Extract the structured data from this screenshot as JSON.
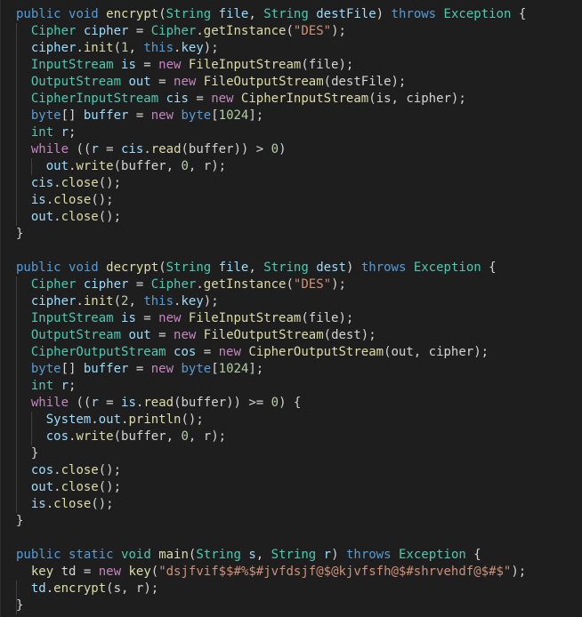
{
  "editor": {
    "language": "java",
    "theme_colors": {
      "background": "#1e1e1e",
      "keyword": "#569cd6",
      "type": "#4ec9b0",
      "function": "#dcdcaa",
      "variable": "#9cdcfe",
      "control": "#c586c0",
      "string": "#ce9178",
      "number": "#b5cea8",
      "plain": "#d4d4d4"
    },
    "lines": [
      [
        [
          "kw",
          "public"
        ],
        [
          "pl",
          " "
        ],
        [
          "kw",
          "void"
        ],
        [
          "pl",
          " "
        ],
        [
          "fn",
          "encrypt"
        ],
        [
          "pl",
          "("
        ],
        [
          "ty",
          "String"
        ],
        [
          "pl",
          " "
        ],
        [
          "var",
          "file"
        ],
        [
          "pl",
          ", "
        ],
        [
          "ty",
          "String"
        ],
        [
          "pl",
          " "
        ],
        [
          "var",
          "destFile"
        ],
        [
          "pl",
          ") "
        ],
        [
          "kw",
          "throws"
        ],
        [
          "pl",
          " "
        ],
        [
          "ty",
          "Exception"
        ],
        [
          "pl",
          " {"
        ]
      ],
      [
        [
          "pl",
          "  "
        ],
        [
          "ty",
          "Cipher"
        ],
        [
          "pl",
          " "
        ],
        [
          "var",
          "cipher"
        ],
        [
          "pl",
          " = "
        ],
        [
          "ty",
          "Cipher"
        ],
        [
          "pl",
          "."
        ],
        [
          "fn",
          "getInstance"
        ],
        [
          "pl",
          "("
        ],
        [
          "str",
          "\"DES\""
        ],
        [
          "pl",
          ");"
        ]
      ],
      [
        [
          "pl",
          "  "
        ],
        [
          "var",
          "cipher"
        ],
        [
          "pl",
          "."
        ],
        [
          "fn",
          "init"
        ],
        [
          "pl",
          "("
        ],
        [
          "num",
          "1"
        ],
        [
          "pl",
          ", "
        ],
        [
          "kw",
          "this"
        ],
        [
          "pl",
          "."
        ],
        [
          "var",
          "key"
        ],
        [
          "pl",
          ");"
        ]
      ],
      [
        [
          "pl",
          "  "
        ],
        [
          "ty",
          "InputStream"
        ],
        [
          "pl",
          " "
        ],
        [
          "var",
          "is"
        ],
        [
          "pl",
          " = "
        ],
        [
          "ctl",
          "new"
        ],
        [
          "pl",
          " "
        ],
        [
          "fn",
          "FileInputStream"
        ],
        [
          "pl",
          "(file);"
        ]
      ],
      [
        [
          "pl",
          "  "
        ],
        [
          "ty",
          "OutputStream"
        ],
        [
          "pl",
          " "
        ],
        [
          "var",
          "out"
        ],
        [
          "pl",
          " = "
        ],
        [
          "ctl",
          "new"
        ],
        [
          "pl",
          " "
        ],
        [
          "fn",
          "FileOutputStream"
        ],
        [
          "pl",
          "(destFile);"
        ]
      ],
      [
        [
          "pl",
          "  "
        ],
        [
          "ty",
          "CipherInputStream"
        ],
        [
          "pl",
          " "
        ],
        [
          "var",
          "cis"
        ],
        [
          "pl",
          " = "
        ],
        [
          "ctl",
          "new"
        ],
        [
          "pl",
          " "
        ],
        [
          "fn",
          "CipherInputStream"
        ],
        [
          "pl",
          "(is, cipher);"
        ]
      ],
      [
        [
          "pl",
          "  "
        ],
        [
          "kw",
          "byte"
        ],
        [
          "pl",
          "[] "
        ],
        [
          "var",
          "buffer"
        ],
        [
          "pl",
          " = "
        ],
        [
          "ctl",
          "new"
        ],
        [
          "pl",
          " "
        ],
        [
          "kw",
          "byte"
        ],
        [
          "pl",
          "["
        ],
        [
          "num",
          "1024"
        ],
        [
          "pl",
          "];"
        ]
      ],
      [
        [
          "pl",
          "  "
        ],
        [
          "ty",
          "int"
        ],
        [
          "pl",
          " "
        ],
        [
          "var",
          "r"
        ],
        [
          "pl",
          ";"
        ]
      ],
      [
        [
          "pl",
          "  "
        ],
        [
          "ctl",
          "while"
        ],
        [
          "pl",
          " (("
        ],
        [
          "var",
          "r"
        ],
        [
          "pl",
          " = "
        ],
        [
          "var",
          "cis"
        ],
        [
          "pl",
          "."
        ],
        [
          "fn",
          "read"
        ],
        [
          "pl",
          "(buffer)) > "
        ],
        [
          "num",
          "0"
        ],
        [
          "pl",
          ")"
        ]
      ],
      [
        [
          "pl",
          "    "
        ],
        [
          "var",
          "out"
        ],
        [
          "pl",
          "."
        ],
        [
          "fn",
          "write"
        ],
        [
          "pl",
          "(buffer, "
        ],
        [
          "num",
          "0"
        ],
        [
          "pl",
          ", r);"
        ]
      ],
      [
        [
          "pl",
          "  "
        ],
        [
          "var",
          "cis"
        ],
        [
          "pl",
          "."
        ],
        [
          "fn",
          "close"
        ],
        [
          "pl",
          "();"
        ]
      ],
      [
        [
          "pl",
          "  "
        ],
        [
          "var",
          "is"
        ],
        [
          "pl",
          "."
        ],
        [
          "fn",
          "close"
        ],
        [
          "pl",
          "();"
        ]
      ],
      [
        [
          "pl",
          "  "
        ],
        [
          "var",
          "out"
        ],
        [
          "pl",
          "."
        ],
        [
          "fn",
          "close"
        ],
        [
          "pl",
          "();"
        ]
      ],
      [
        [
          "pl",
          "}"
        ]
      ],
      [],
      [
        [
          "kw",
          "public"
        ],
        [
          "pl",
          " "
        ],
        [
          "kw",
          "void"
        ],
        [
          "pl",
          " "
        ],
        [
          "fn",
          "decrypt"
        ],
        [
          "pl",
          "("
        ],
        [
          "ty",
          "String"
        ],
        [
          "pl",
          " "
        ],
        [
          "var",
          "file"
        ],
        [
          "pl",
          ", "
        ],
        [
          "ty",
          "String"
        ],
        [
          "pl",
          " "
        ],
        [
          "var",
          "dest"
        ],
        [
          "pl",
          ") "
        ],
        [
          "kw",
          "throws"
        ],
        [
          "pl",
          " "
        ],
        [
          "ty",
          "Exception"
        ],
        [
          "pl",
          " {"
        ]
      ],
      [
        [
          "pl",
          "  "
        ],
        [
          "ty",
          "Cipher"
        ],
        [
          "pl",
          " "
        ],
        [
          "var",
          "cipher"
        ],
        [
          "pl",
          " = "
        ],
        [
          "ty",
          "Cipher"
        ],
        [
          "pl",
          "."
        ],
        [
          "fn",
          "getInstance"
        ],
        [
          "pl",
          "("
        ],
        [
          "str",
          "\"DES\""
        ],
        [
          "pl",
          ");"
        ]
      ],
      [
        [
          "pl",
          "  "
        ],
        [
          "var",
          "cipher"
        ],
        [
          "pl",
          "."
        ],
        [
          "fn",
          "init"
        ],
        [
          "pl",
          "("
        ],
        [
          "num",
          "2"
        ],
        [
          "pl",
          ", "
        ],
        [
          "kw",
          "this"
        ],
        [
          "pl",
          "."
        ],
        [
          "var",
          "key"
        ],
        [
          "pl",
          ");"
        ]
      ],
      [
        [
          "pl",
          "  "
        ],
        [
          "ty",
          "InputStream"
        ],
        [
          "pl",
          " "
        ],
        [
          "var",
          "is"
        ],
        [
          "pl",
          " = "
        ],
        [
          "ctl",
          "new"
        ],
        [
          "pl",
          " "
        ],
        [
          "fn",
          "FileInputStream"
        ],
        [
          "pl",
          "(file);"
        ]
      ],
      [
        [
          "pl",
          "  "
        ],
        [
          "ty",
          "OutputStream"
        ],
        [
          "pl",
          " "
        ],
        [
          "var",
          "out"
        ],
        [
          "pl",
          " = "
        ],
        [
          "ctl",
          "new"
        ],
        [
          "pl",
          " "
        ],
        [
          "fn",
          "FileOutputStream"
        ],
        [
          "pl",
          "(dest);"
        ]
      ],
      [
        [
          "pl",
          "  "
        ],
        [
          "ty",
          "CipherOutputStream"
        ],
        [
          "pl",
          " "
        ],
        [
          "var",
          "cos"
        ],
        [
          "pl",
          " = "
        ],
        [
          "ctl",
          "new"
        ],
        [
          "pl",
          " "
        ],
        [
          "fn",
          "CipherOutputStream"
        ],
        [
          "pl",
          "(out, cipher);"
        ]
      ],
      [
        [
          "pl",
          "  "
        ],
        [
          "kw",
          "byte"
        ],
        [
          "pl",
          "[] "
        ],
        [
          "var",
          "buffer"
        ],
        [
          "pl",
          " = "
        ],
        [
          "ctl",
          "new"
        ],
        [
          "pl",
          " "
        ],
        [
          "kw",
          "byte"
        ],
        [
          "pl",
          "["
        ],
        [
          "num",
          "1024"
        ],
        [
          "pl",
          "];"
        ]
      ],
      [
        [
          "pl",
          "  "
        ],
        [
          "ty",
          "int"
        ],
        [
          "pl",
          " "
        ],
        [
          "var",
          "r"
        ],
        [
          "pl",
          ";"
        ]
      ],
      [
        [
          "pl",
          "  "
        ],
        [
          "ctl",
          "while"
        ],
        [
          "pl",
          " (("
        ],
        [
          "var",
          "r"
        ],
        [
          "pl",
          " = "
        ],
        [
          "var",
          "is"
        ],
        [
          "pl",
          "."
        ],
        [
          "fn",
          "read"
        ],
        [
          "pl",
          "(buffer)) >= "
        ],
        [
          "num",
          "0"
        ],
        [
          "pl",
          ") {"
        ]
      ],
      [
        [
          "pl",
          "    "
        ],
        [
          "var",
          "System"
        ],
        [
          "pl",
          "."
        ],
        [
          "var",
          "out"
        ],
        [
          "pl",
          "."
        ],
        [
          "fn",
          "println"
        ],
        [
          "pl",
          "();"
        ]
      ],
      [
        [
          "pl",
          "    "
        ],
        [
          "var",
          "cos"
        ],
        [
          "pl",
          "."
        ],
        [
          "fn",
          "write"
        ],
        [
          "pl",
          "(buffer, "
        ],
        [
          "num",
          "0"
        ],
        [
          "pl",
          ", r);"
        ]
      ],
      [
        [
          "pl",
          "  }"
        ]
      ],
      [
        [
          "pl",
          "  "
        ],
        [
          "var",
          "cos"
        ],
        [
          "pl",
          "."
        ],
        [
          "fn",
          "close"
        ],
        [
          "pl",
          "();"
        ]
      ],
      [
        [
          "pl",
          "  "
        ],
        [
          "var",
          "out"
        ],
        [
          "pl",
          "."
        ],
        [
          "fn",
          "close"
        ],
        [
          "pl",
          "();"
        ]
      ],
      [
        [
          "pl",
          "  "
        ],
        [
          "var",
          "is"
        ],
        [
          "pl",
          "."
        ],
        [
          "fn",
          "close"
        ],
        [
          "pl",
          "();"
        ]
      ],
      [
        [
          "pl",
          "}"
        ]
      ],
      [],
      [
        [
          "kw",
          "public"
        ],
        [
          "pl",
          " "
        ],
        [
          "kw",
          "static"
        ],
        [
          "pl",
          " "
        ],
        [
          "ty",
          "void"
        ],
        [
          "pl",
          " "
        ],
        [
          "fn",
          "main"
        ],
        [
          "pl",
          "("
        ],
        [
          "ty",
          "String"
        ],
        [
          "pl",
          " "
        ],
        [
          "var",
          "s"
        ],
        [
          "pl",
          ", "
        ],
        [
          "ty",
          "String"
        ],
        [
          "pl",
          " "
        ],
        [
          "var",
          "r"
        ],
        [
          "pl",
          ") "
        ],
        [
          "kw",
          "throws"
        ],
        [
          "pl",
          " "
        ],
        [
          "ty",
          "Exception"
        ],
        [
          "pl",
          " {"
        ]
      ],
      [
        [
          "pl",
          "  "
        ],
        [
          "fn",
          "key"
        ],
        [
          "pl",
          " td = "
        ],
        [
          "ctl",
          "new"
        ],
        [
          "pl",
          " "
        ],
        [
          "fn",
          "key"
        ],
        [
          "pl",
          "("
        ],
        [
          "str",
          "\"dsjfvif$$#%$#jvfdsjf@$@kjvfsfh@$#shrvehdf@$#$\""
        ],
        [
          "pl",
          ");"
        ]
      ],
      [
        [
          "pl",
          "  "
        ],
        [
          "var",
          "td"
        ],
        [
          "pl",
          "."
        ],
        [
          "fn",
          "encrypt"
        ],
        [
          "pl",
          "(s, r);"
        ]
      ],
      [
        [
          "pl",
          "}"
        ]
      ]
    ]
  }
}
